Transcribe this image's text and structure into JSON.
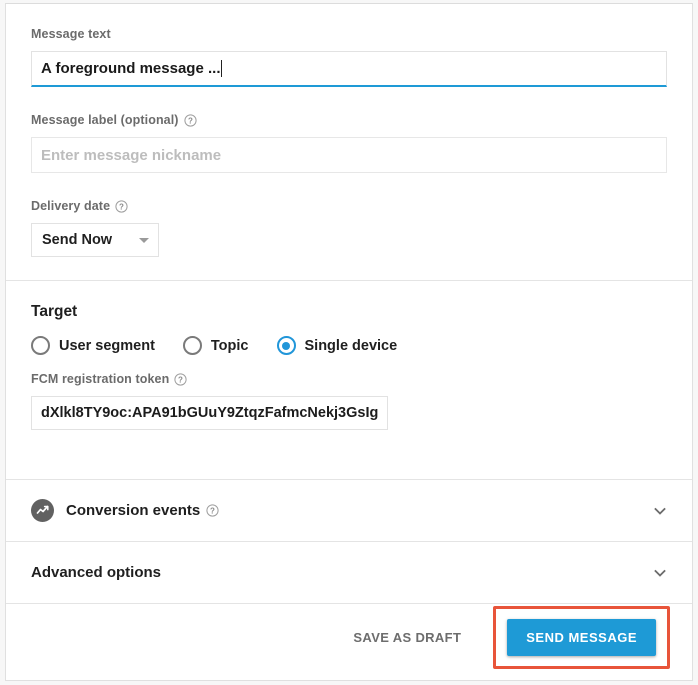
{
  "form": {
    "message_text": {
      "label": "Message text",
      "value": "A foreground message ..."
    },
    "message_label": {
      "label": "Message label (optional)",
      "placeholder": "Enter message nickname",
      "value": ""
    },
    "delivery_date": {
      "label": "Delivery date",
      "selected": "Send Now",
      "options": [
        "Send Now"
      ]
    }
  },
  "target": {
    "title": "Target",
    "options": [
      {
        "label": "User segment",
        "checked": false
      },
      {
        "label": "Topic",
        "checked": false
      },
      {
        "label": "Single device",
        "checked": true
      }
    ],
    "token_field": {
      "label": "FCM registration token",
      "value": "dXlkl8TY9oc:APA91bGUuY9ZtqzFafmcNekj3GsIg"
    }
  },
  "accordions": [
    {
      "title": "Conversion events",
      "has_help": true,
      "has_icon": true
    },
    {
      "title": "Advanced options",
      "has_help": false,
      "has_icon": false
    }
  ],
  "footer": {
    "save_draft_label": "SAVE AS DRAFT",
    "send_label": "SEND MESSAGE"
  },
  "colors": {
    "accent_blue": "#1e9ad6",
    "radio_blue": "#2196d9",
    "annotation_red": "#e8543a",
    "label_gray": "#6b6b6b",
    "border_gray": "#e2e2e2"
  },
  "icons": {
    "help": "help-circle-icon",
    "chevron_down": "chevron-down-icon",
    "conversion": "conversion-trend-icon",
    "select_caret": "caret-down-icon"
  }
}
